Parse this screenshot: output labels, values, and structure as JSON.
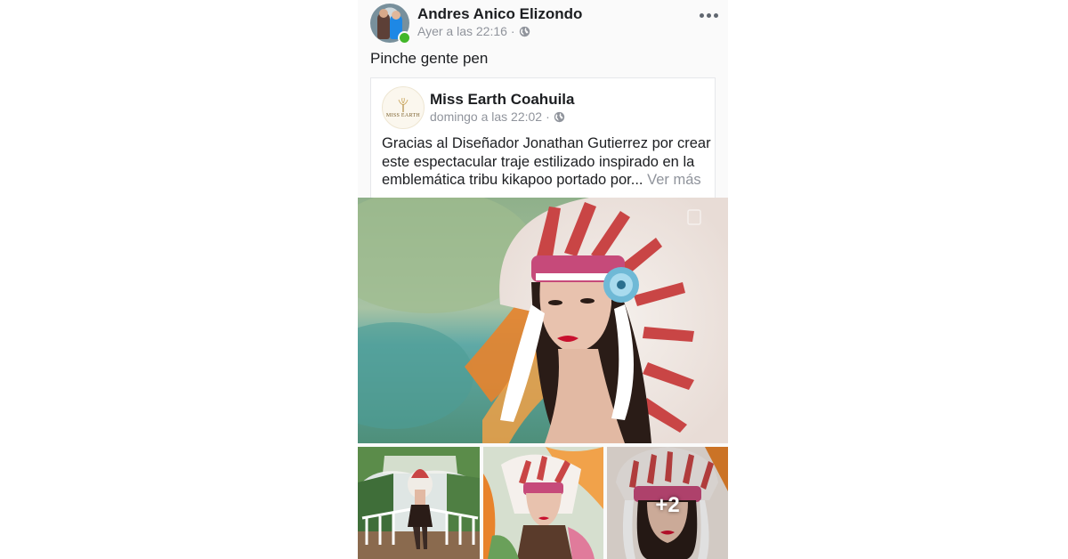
{
  "post": {
    "author_name": "Andres Anico Elizondo",
    "timestamp": "Ayer a las 22:16",
    "separator": "·",
    "privacy_icon": "globe-icon",
    "online_status_color": "#42b72a",
    "text": "Pinche gente pen",
    "more_icon": "more-icon"
  },
  "shared": {
    "page_name": "Miss Earth Coahuila",
    "logo_text": "MISS EARTH",
    "timestamp": "domingo a las 22:02",
    "separator": "·",
    "privacy_icon": "globe-icon",
    "text_lines": [
      "Gracias al Diseñador Jonathan Gutierrez por crear",
      "este espectacular traje estilizado inspirado en la",
      "emblemática tribu kikapoo portado por..."
    ],
    "see_more": "Ver más"
  },
  "photos": {
    "more_count": "+2"
  },
  "colors": {
    "text_primary": "#1c1e21",
    "text_secondary": "#90949c",
    "background": "#fafafa"
  }
}
